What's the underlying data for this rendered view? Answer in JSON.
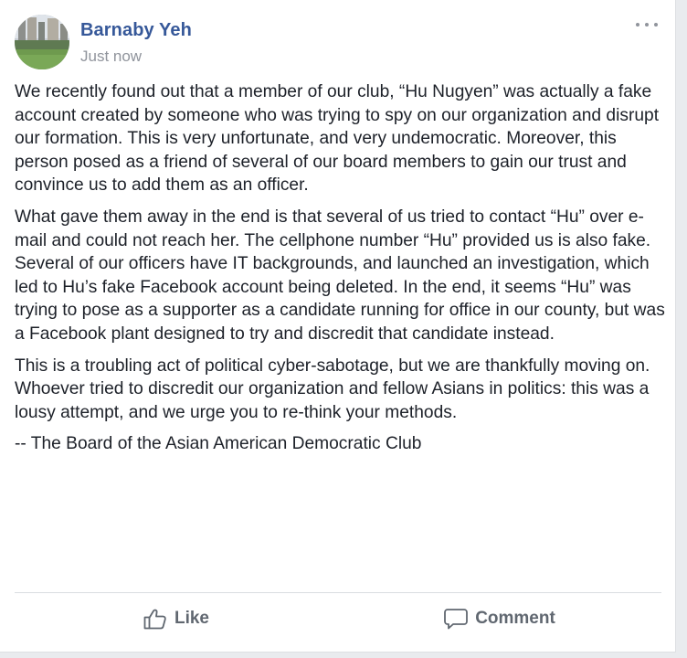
{
  "post": {
    "author_name": "Barnaby Yeh",
    "timestamp": "Just now",
    "more_icon": "ellipsis-icon",
    "paragraphs": [
      "We recently found out that a member of our club, “Hu Nugyen” was actually a fake account created by someone who was trying to spy on our organization and disrupt our formation. This is very unfortunate, and very undemocratic. Moreover, this person posed as a friend of several of our board members to gain our trust and convince us to add them as an officer.",
      "What gave them away in the end is that several of us tried to contact “Hu” over e-mail and could not reach her. The cellphone number “Hu” provided us is also fake. Several of our officers have IT backgrounds, and launched an investigation, which led to Hu’s fake Facebook account being deleted. In the end, it seems “Hu” was trying to pose as a supporter as a candidate running for office in our county, but was a Facebook plant designed to try and discredit that candidate instead.",
      "This is a troubling act of political cyber-sabotage, but we are thankfully moving on. Whoever tried to discredit our organization and fellow Asians in politics: this was a lousy attempt, and we urge you to re-think your methods.",
      "-- The Board of the Asian American Democratic Club"
    ]
  },
  "actions": {
    "like_label": "Like",
    "like_icon": "thumbs-up-icon",
    "comment_label": "Comment",
    "comment_icon": "speech-bubble-icon"
  },
  "colors": {
    "author_link": "#365899",
    "secondary_text": "#90949c",
    "body_text": "#1d2129",
    "action_text": "#606770",
    "page_background": "#e9ebee"
  }
}
